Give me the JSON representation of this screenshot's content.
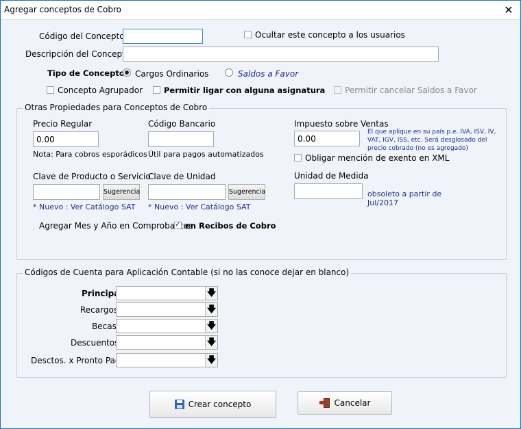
{
  "window": {
    "title": "Agregar conceptos de Cobro",
    "close_glyph": "✕"
  },
  "concept": {
    "code_label": "Código del Concepto",
    "code_value": "",
    "hide_label": "Ocultar este concepto a los usuarios",
    "desc_label": "Descripción del Concepto",
    "desc_value": "",
    "type_label": "Tipo de Concepto",
    "type_ordinary": "Cargos Ordinarios",
    "type_favor": "Saldos a Favor",
    "grouper_label": "Concepto Agrupador",
    "link_label": "Permitir ligar con alguna asignatura",
    "cancel_favor_label": "Permitir cancelar Saldos a Favor"
  },
  "props": {
    "title": "Otras Propiedades para Conceptos de Cobro",
    "price_label": "Precio Regular",
    "price_value": "0.00",
    "price_note": "Nota: Para cobros esporádicos",
    "bank_label": "Código Bancario",
    "bank_value": "",
    "bank_note": "Útil para pagos automatizados",
    "tax_label": "Impuesto sobre Ventas",
    "tax_help": "El que aplique en su país p.e. IVA, ISV, IV, VAT, IGV, ISS, etc. Será desglosado del precio cobrado (no es agregado)",
    "tax_value": "0.00",
    "exempt_label": "Obligar mención de exento en XML",
    "product_label": "Clave de Producto o Servicio",
    "product_value": "",
    "product_sug": "Sugerencia",
    "product_link": "* Nuevo : Ver Catálogo SAT",
    "unit_label": "Clave de Unidad",
    "unit_value": "",
    "unit_sug": "Sugerencia",
    "unit_link": "* Nuevo : Ver Catálogo SAT",
    "measure_label": "Unidad de Medida",
    "measure_value": "",
    "measure_note": "obsoleto a partir de Jul/2017",
    "month_label": "Agregar Mes y Año en Comprobantes",
    "month_check_label": "en Recibos de Cobro"
  },
  "accounts": {
    "title": "Códigos de Cuenta para Aplicación Contable  (si no las conoce dejar en blanco)",
    "rows": [
      {
        "label": "Principal",
        "value": ""
      },
      {
        "label": "Recargos",
        "value": ""
      },
      {
        "label": "Becas",
        "value": ""
      },
      {
        "label": "Descuentos",
        "value": ""
      },
      {
        "label": "Desctos. x Pronto Pago",
        "value": ""
      }
    ],
    "arrow_glyph": "🡇"
  },
  "buttons": {
    "create": "Crear concepto",
    "cancel": "Cancelar"
  }
}
